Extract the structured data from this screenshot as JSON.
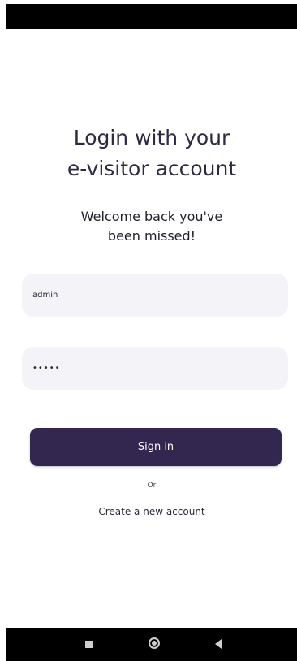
{
  "header": {
    "title_line1": "Login with your",
    "title_line2": "e-visitor account",
    "subtitle_line1": "Welcome back you've",
    "subtitle_line2": "been missed!"
  },
  "form": {
    "username_value": "admin",
    "password_value": "admin"
  },
  "actions": {
    "signin_label": "Sign in",
    "or_label": "Or",
    "create_account_label": "Create a new account"
  },
  "navigation": {
    "icons": [
      "recents-square-icon",
      "home-circle-icon",
      "back-triangle-icon"
    ]
  },
  "colors": {
    "primary_button": "#33264f",
    "field_background": "#f4f4f8",
    "title_text": "#2d2a42"
  }
}
